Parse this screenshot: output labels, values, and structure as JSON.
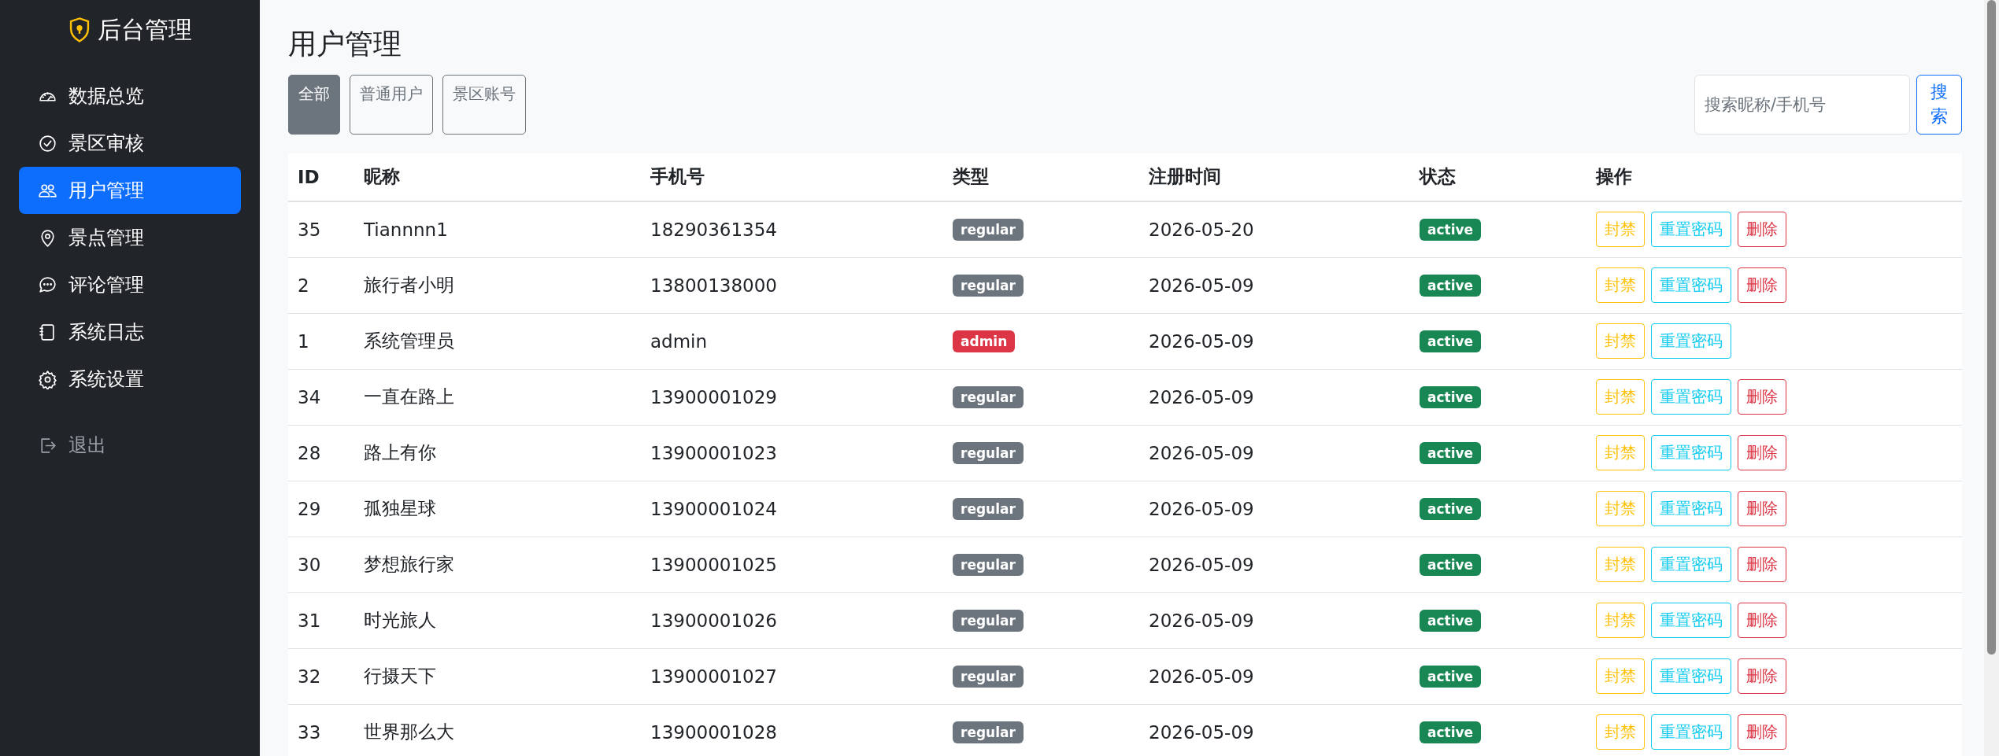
{
  "sidebar": {
    "brand": "后台管理",
    "items": [
      {
        "label": "数据总览",
        "selected": false
      },
      {
        "label": "景区审核",
        "selected": false
      },
      {
        "label": "用户管理",
        "selected": true
      },
      {
        "label": "景点管理",
        "selected": false
      },
      {
        "label": "评论管理",
        "selected": false
      },
      {
        "label": "系统日志",
        "selected": false
      },
      {
        "label": "系统设置",
        "selected": false
      }
    ],
    "logout": "退出"
  },
  "page_title": "用户管理",
  "filters": [
    {
      "label": "全部",
      "selected": true
    },
    {
      "label": "普通用户",
      "selected": false
    },
    {
      "label": "景区账号",
      "selected": false
    }
  ],
  "search": {
    "placeholder": "搜索昵称/手机号",
    "button": "搜索"
  },
  "table": {
    "columns": [
      "ID",
      "昵称",
      "手机号",
      "类型",
      "注册时间",
      "状态",
      "操作"
    ],
    "rows": [
      {
        "id": "35",
        "nickname": "Tiannnn1",
        "phone": "18290361354",
        "type": {
          "label": "regular",
          "color": "#6c757d"
        },
        "registered": "2026-05-20",
        "status": {
          "label": "active",
          "color": "#198754"
        },
        "actions": [
          {
            "kind": "ban",
            "label": "封禁"
          },
          {
            "kind": "reset",
            "label": "重置密码"
          },
          {
            "kind": "delete",
            "label": "删除"
          }
        ]
      },
      {
        "id": "2",
        "nickname": "旅行者小明",
        "phone": "13800138000",
        "type": {
          "label": "regular",
          "color": "#6c757d"
        },
        "registered": "2026-05-09",
        "status": {
          "label": "active",
          "color": "#198754"
        },
        "actions": [
          {
            "kind": "ban",
            "label": "封禁"
          },
          {
            "kind": "reset",
            "label": "重置密码"
          },
          {
            "kind": "delete",
            "label": "删除"
          }
        ]
      },
      {
        "id": "1",
        "nickname": "系统管理员",
        "phone": "admin",
        "type": {
          "label": "admin",
          "color": "#dc3545"
        },
        "registered": "2026-05-09",
        "status": {
          "label": "active",
          "color": "#198754"
        },
        "actions": [
          {
            "kind": "ban",
            "label": "封禁"
          },
          {
            "kind": "reset",
            "label": "重置密码"
          }
        ]
      },
      {
        "id": "34",
        "nickname": "一直在路上",
        "phone": "13900001029",
        "type": {
          "label": "regular",
          "color": "#6c757d"
        },
        "registered": "2026-05-09",
        "status": {
          "label": "active",
          "color": "#198754"
        },
        "actions": [
          {
            "kind": "ban",
            "label": "封禁"
          },
          {
            "kind": "reset",
            "label": "重置密码"
          },
          {
            "kind": "delete",
            "label": "删除"
          }
        ]
      },
      {
        "id": "28",
        "nickname": "路上有你",
        "phone": "13900001023",
        "type": {
          "label": "regular",
          "color": "#6c757d"
        },
        "registered": "2026-05-09",
        "status": {
          "label": "active",
          "color": "#198754"
        },
        "actions": [
          {
            "kind": "ban",
            "label": "封禁"
          },
          {
            "kind": "reset",
            "label": "重置密码"
          },
          {
            "kind": "delete",
            "label": "删除"
          }
        ]
      },
      {
        "id": "29",
        "nickname": "孤独星球",
        "phone": "13900001024",
        "type": {
          "label": "regular",
          "color": "#6c757d"
        },
        "registered": "2026-05-09",
        "status": {
          "label": "active",
          "color": "#198754"
        },
        "actions": [
          {
            "kind": "ban",
            "label": "封禁"
          },
          {
            "kind": "reset",
            "label": "重置密码"
          },
          {
            "kind": "delete",
            "label": "删除"
          }
        ]
      },
      {
        "id": "30",
        "nickname": "梦想旅行家",
        "phone": "13900001025",
        "type": {
          "label": "regular",
          "color": "#6c757d"
        },
        "registered": "2026-05-09",
        "status": {
          "label": "active",
          "color": "#198754"
        },
        "actions": [
          {
            "kind": "ban",
            "label": "封禁"
          },
          {
            "kind": "reset",
            "label": "重置密码"
          },
          {
            "kind": "delete",
            "label": "删除"
          }
        ]
      },
      {
        "id": "31",
        "nickname": "时光旅人",
        "phone": "13900001026",
        "type": {
          "label": "regular",
          "color": "#6c757d"
        },
        "registered": "2026-05-09",
        "status": {
          "label": "active",
          "color": "#198754"
        },
        "actions": [
          {
            "kind": "ban",
            "label": "封禁"
          },
          {
            "kind": "reset",
            "label": "重置密码"
          },
          {
            "kind": "delete",
            "label": "删除"
          }
        ]
      },
      {
        "id": "32",
        "nickname": "行摄天下",
        "phone": "13900001027",
        "type": {
          "label": "regular",
          "color": "#6c757d"
        },
        "registered": "2026-05-09",
        "status": {
          "label": "active",
          "color": "#198754"
        },
        "actions": [
          {
            "kind": "ban",
            "label": "封禁"
          },
          {
            "kind": "reset",
            "label": "重置密码"
          },
          {
            "kind": "delete",
            "label": "删除"
          }
        ]
      },
      {
        "id": "33",
        "nickname": "世界那么大",
        "phone": "13900001028",
        "type": {
          "label": "regular",
          "color": "#6c757d"
        },
        "registered": "2026-05-09",
        "status": {
          "label": "active",
          "color": "#198754"
        },
        "actions": [
          {
            "kind": "ban",
            "label": "封禁"
          },
          {
            "kind": "reset",
            "label": "重置密码"
          },
          {
            "kind": "delete",
            "label": "删除"
          }
        ]
      }
    ]
  }
}
